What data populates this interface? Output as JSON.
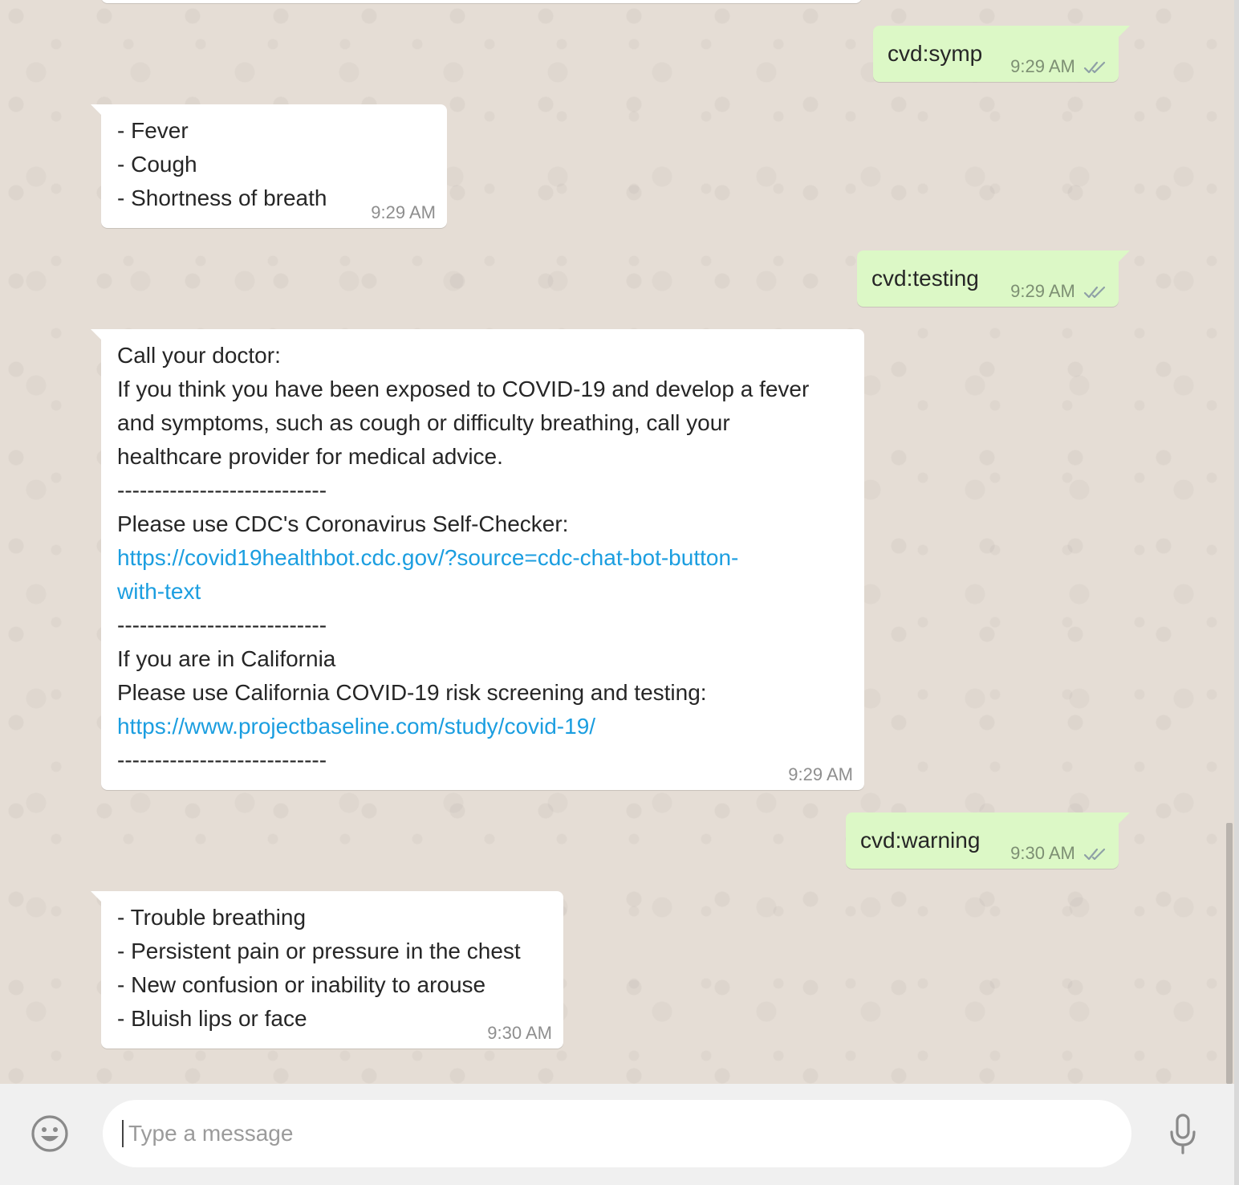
{
  "colors": {
    "chat_background": "#e5ddd5",
    "incoming_bubble": "#ffffff",
    "outgoing_bubble": "#dcf8c6",
    "link": "#1b9ee0",
    "read_ticks": "#8fa0a6"
  },
  "messages": [
    {
      "direction": "outgoing",
      "lines": [
        "cvd:symp"
      ],
      "time": "9:29 AM",
      "status_icon": "double-check-icon"
    },
    {
      "direction": "incoming",
      "lines": [
        "- Fever",
        "- Cough",
        "- Shortness of breath"
      ],
      "time": "9:29 AM"
    },
    {
      "direction": "outgoing",
      "lines": [
        "cvd:testing"
      ],
      "time": "9:29 AM",
      "status_icon": "double-check-icon"
    },
    {
      "direction": "incoming",
      "lines": [
        "Call your doctor:",
        "If you think you have been exposed to COVID-19 and develop a fever",
        "and symptoms, such as cough or difficulty breathing, call your",
        "healthcare provider for medical advice.",
        "----------------------------",
        "Please use CDC's Coronavirus Self-Checker:",
        "https://covid19healthbot.cdc.gov/?source=cdc-chat-bot-button-",
        "with-text",
        "----------------------------",
        "If you are in California",
        "Please use California COVID-19 risk screening and testing:",
        "https://www.projectbaseline.com/study/covid-19/",
        "----------------------------"
      ],
      "time": "9:29 AM"
    },
    {
      "direction": "outgoing",
      "lines": [
        "cvd:warning"
      ],
      "time": "9:30 AM",
      "status_icon": "double-check-icon"
    },
    {
      "direction": "incoming",
      "lines": [
        "- Trouble breathing",
        "- Persistent pain or pressure in the chest",
        "- New confusion or inability to arouse",
        "- Bluish lips or face"
      ],
      "time": "9:30 AM"
    }
  ],
  "composer": {
    "placeholder": "Type a message",
    "value": "",
    "emoji_icon": "smiley-icon",
    "mic_icon": "microphone-icon"
  }
}
